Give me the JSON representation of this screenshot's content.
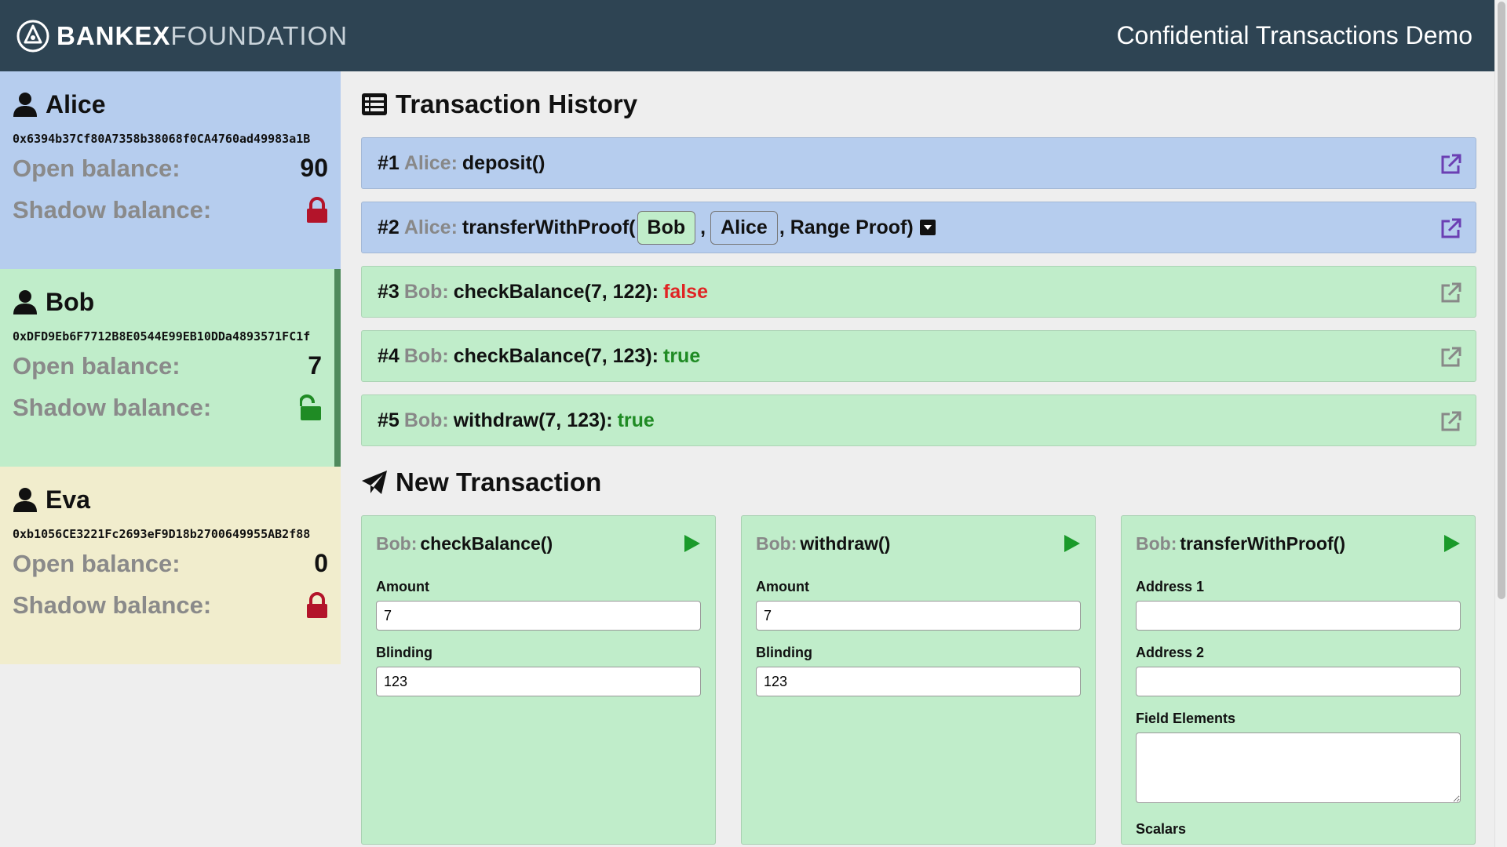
{
  "header": {
    "brand_bold": "BANKEX",
    "brand_light": "FOUNDATION",
    "app_title": "Confidential Transactions Demo"
  },
  "accounts": [
    {
      "name": "Alice",
      "address": "0x6394b37Cf80A7358b38068f0CA4760ad49983a1B",
      "open_label": "Open balance:",
      "open_value": "90",
      "shadow_label": "Shadow balance:",
      "shadow_state": "locked",
      "shadow_color": "#b3142a"
    },
    {
      "name": "Bob",
      "address": "0xDFD9Eb6F7712B8E0544E99EB10DDa4893571FC1f",
      "open_label": "Open balance:",
      "open_value": "7",
      "shadow_label": "Shadow balance:",
      "shadow_state": "unlocked",
      "shadow_color": "#1f8b24"
    },
    {
      "name": "Eva",
      "address": "0xb1056CE3221Fc2693eF9D18b2700649955AB2f88",
      "open_label": "Open balance:",
      "open_value": "0",
      "shadow_label": "Shadow balance:",
      "shadow_state": "locked",
      "shadow_color": "#b3142a"
    }
  ],
  "history": {
    "title": "Transaction History",
    "items": [
      {
        "num": "#1",
        "who": "Alice:",
        "call": "deposit()",
        "result": "",
        "color": "blue",
        "link_icon": "external-link-icon"
      },
      {
        "num": "#2",
        "who": "Alice:",
        "call_prefix": "transferWithProof(",
        "chip1": "Bob",
        "sep": ",",
        "chip2": "Alice",
        "call_suffix": ", Range Proof)",
        "color": "blue",
        "link_icon": "external-link-icon"
      },
      {
        "num": "#3",
        "who": "Bob:",
        "call": "checkBalance(7, 122):",
        "result": "false",
        "color": "green",
        "link_icon": "external-link-icon"
      },
      {
        "num": "#4",
        "who": "Bob:",
        "call": "checkBalance(7, 123):",
        "result": "true",
        "color": "green",
        "link_icon": "external-link-icon"
      },
      {
        "num": "#5",
        "who": "Bob:",
        "call": "withdraw(7, 123):",
        "result": "true",
        "color": "green",
        "link_icon": "external-link-icon"
      }
    ]
  },
  "new_tx": {
    "title": "New Transaction",
    "cards": [
      {
        "who": "Bob:",
        "method": "checkBalance()",
        "fields": [
          {
            "label": "Amount",
            "value": "7"
          },
          {
            "label": "Blinding",
            "value": "123"
          }
        ]
      },
      {
        "who": "Bob:",
        "method": "withdraw()",
        "fields": [
          {
            "label": "Amount",
            "value": "7"
          },
          {
            "label": "Blinding",
            "value": "123"
          }
        ]
      },
      {
        "who": "Bob:",
        "method": "transferWithProof()",
        "fields": [
          {
            "label": "Address 1",
            "value": ""
          },
          {
            "label": "Address 2",
            "value": ""
          },
          {
            "label": "Field Elements",
            "value": ""
          },
          {
            "label": "Scalars",
            "value": ""
          }
        ]
      }
    ]
  },
  "colors": {
    "header_bg": "#2e4453",
    "alice_bg": "#b6cdee",
    "bob_bg": "#c0edca",
    "eva_bg": "#f1edcd",
    "false_red": "#e02424",
    "true_green": "#1f8b24",
    "play_green": "#1a9a2a",
    "link_purple": "#6b3fb3"
  }
}
